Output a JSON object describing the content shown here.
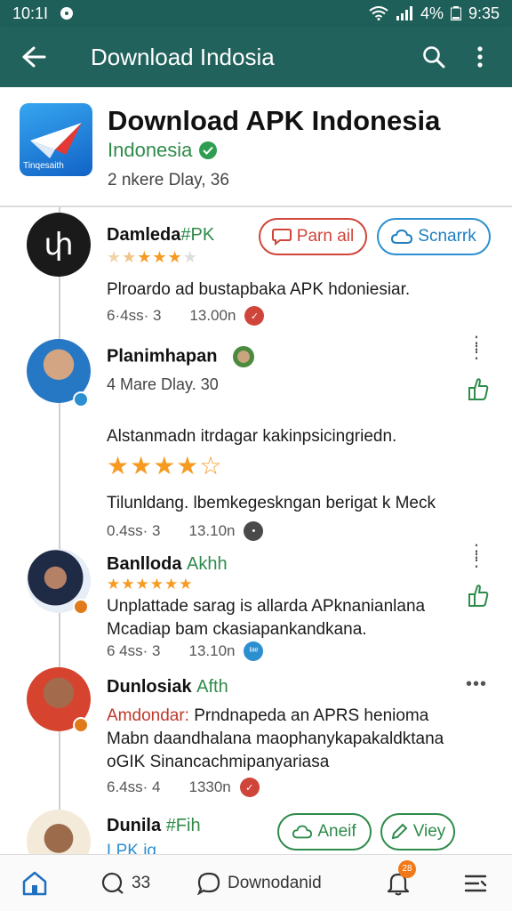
{
  "status": {
    "time_left": "10:1I",
    "battery": "4%",
    "clock": "9:35"
  },
  "appbar": {
    "title": "Download Indosia",
    "icons": [
      "back-arrow-icon",
      "search-icon",
      "more-vert-icon"
    ]
  },
  "header": {
    "title": "Download APK Indonesia",
    "subtitle": "Indonesia",
    "meta": "2 nkere Dlay, 36",
    "logo_caption": "Tinqesaith"
  },
  "posts": [
    {
      "name": "Damleda",
      "tag": "#PK",
      "avatar_text": "փ",
      "buttons": [
        "Parn ail",
        "Scnarrk"
      ],
      "text": "Plroardo ad bustapbaka APK hdoniesiar.",
      "count": "6·4ss· 3",
      "time": "13.00n"
    },
    {
      "name": "Planimhapan",
      "meta": "4 Mare Dlay. 30",
      "text": "Alstanmadn itrdagar kakinpsicingriedn.",
      "rating": "4 of 5",
      "text2": "Tilunldang. lbemkegeskngan berigat k Meck",
      "count": "0.4ss· 3",
      "time": "13.10n"
    },
    {
      "name": "Banlloda",
      "tag": "Akhh",
      "text": "Unplattade sarag is allarda APknanianlana Mcadiap bam ckasiapankandkana.",
      "count": "6 4ss· 3",
      "time": "13.10n",
      "mark_text": "ᴵᵃᵉ"
    },
    {
      "name": "Dunlosiak",
      "tag": "Afth",
      "highlight": "Amdondar:",
      "text": "Prndnapeda an APRS henioma Mabn daandhalana maophanykapakaldktana oGIK Sinancachmipanyariasa",
      "count": "6.4ss· 4",
      "time": "1330n"
    },
    {
      "name": "Dunila",
      "tag": "#Fih",
      "partial": "LPK  ig",
      "buttons": [
        "Aneif",
        "Viey"
      ]
    }
  ],
  "bottom_nav": {
    "comments_count": "33",
    "download_label": "Downodanid",
    "notif_count": "28"
  },
  "colors": {
    "accent": "#22625c",
    "green": "#2e8b4a",
    "star": "#f59b22",
    "red": "#d0453a"
  }
}
